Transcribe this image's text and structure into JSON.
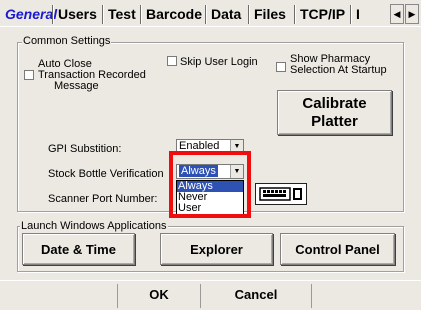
{
  "tabs": [
    "General",
    "Users",
    "Test",
    "Barcode",
    "Data",
    "Files",
    "TCP/IP",
    "I"
  ],
  "scroll_left": "◀",
  "scroll_right": "▶",
  "common_settings": {
    "legend": "Common Settings",
    "auto_close_line1": "Auto Close",
    "auto_close_line2": "Transaction Recorded",
    "auto_close_line3": "Message",
    "skip_user_login": "Skip User Login",
    "show_pharmacy_line1": "Show Pharmacy",
    "show_pharmacy_line2": "Selection At Startup",
    "calibrate_line1": "Calibrate",
    "calibrate_line2": "Platter",
    "gpi_label": "GPI Substition:",
    "gpi_value": "Enabled",
    "stock_label": "Stock Bottle Verification",
    "stock_value": "Always",
    "stock_options": [
      "Always",
      "Never",
      "User"
    ],
    "scanner_label": "Scanner Port Number:"
  },
  "launch": {
    "legend": "Launch Windows Applications",
    "date_time": "Date & Time",
    "explorer": "Explorer",
    "control_panel": "Control Panel"
  },
  "footer": {
    "ok": "OK",
    "cancel": "Cancel"
  },
  "highlight_color": "#f00d0d",
  "selection_color": "#2d52b4",
  "active_tab_color": "#1a1ad0"
}
